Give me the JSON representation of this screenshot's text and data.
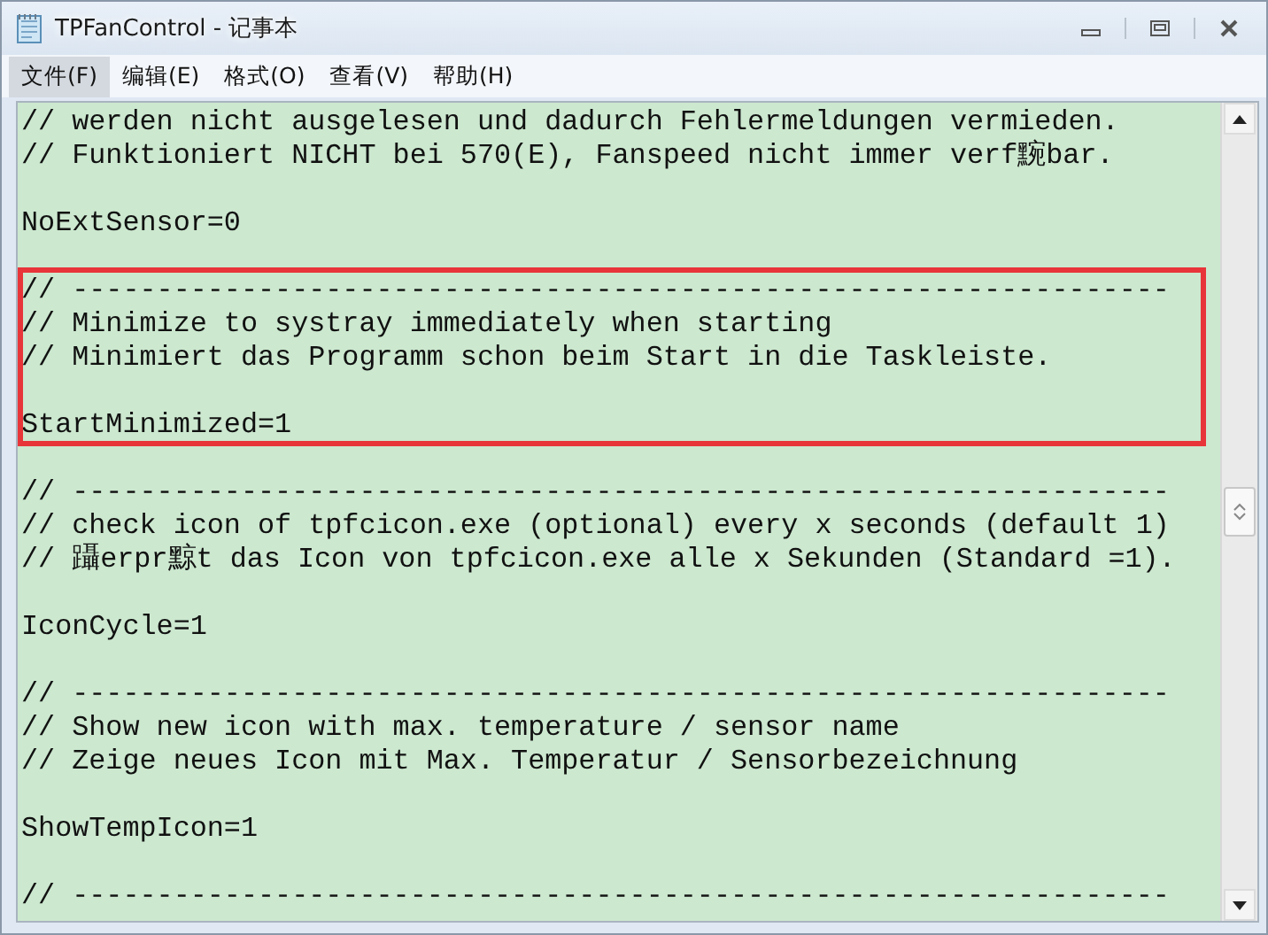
{
  "window": {
    "title": "TPFanControl - 记事本"
  },
  "menu": [
    {
      "label": "文件(F)",
      "selected": true
    },
    {
      "label": "编辑(E)",
      "selected": false
    },
    {
      "label": "格式(O)",
      "selected": false
    },
    {
      "label": "查看(V)",
      "selected": false
    },
    {
      "label": "帮助(H)",
      "selected": false
    }
  ],
  "sections": [
    {
      "highlighted": false,
      "lines": [
        {
          "kind": "text",
          "text": "// werden nicht ausgelesen und dadurch Fehlermeldungen vermieden."
        },
        {
          "kind": "text",
          "text": "// Funktioniert NICHT bei 570(E), Fanspeed nicht immer verf黦bar."
        },
        {
          "kind": "blank"
        },
        {
          "kind": "text",
          "text": "NoExtSensor=0"
        },
        {
          "kind": "blank"
        }
      ]
    },
    {
      "highlighted": true,
      "lines": [
        {
          "kind": "text",
          "text": "// -----------------------------------------------------------------"
        },
        {
          "kind": "text",
          "text": "// Minimize to systray immediately when starting"
        },
        {
          "kind": "text",
          "text": "// Minimiert das Programm schon beim Start in die Taskleiste."
        },
        {
          "kind": "blank"
        },
        {
          "kind": "text",
          "text": "StartMinimized=1"
        }
      ]
    },
    {
      "highlighted": false,
      "lines": [
        {
          "kind": "blank"
        },
        {
          "kind": "text",
          "text": "// -----------------------------------------------------------------"
        },
        {
          "kind": "text",
          "text": "// check icon of tpfcicon.exe (optional) every x seconds (default 1)"
        },
        {
          "kind": "text",
          "text": "// 躡erpr黥t das Icon von tpfcicon.exe alle x Sekunden (Standard =1)."
        },
        {
          "kind": "blank"
        },
        {
          "kind": "text",
          "text": "IconCycle=1"
        },
        {
          "kind": "blank"
        },
        {
          "kind": "text",
          "text": "// -----------------------------------------------------------------"
        },
        {
          "kind": "text",
          "text": "// Show new icon with max. temperature / sensor name"
        },
        {
          "kind": "text",
          "text": "// Zeige neues Icon mit Max. Temperatur / Sensorbezeichnung"
        },
        {
          "kind": "blank"
        },
        {
          "kind": "text",
          "text": "ShowTempIcon=1"
        },
        {
          "kind": "blank"
        },
        {
          "kind": "text",
          "text": "// -----------------------------------------------------------------"
        }
      ]
    }
  ]
}
